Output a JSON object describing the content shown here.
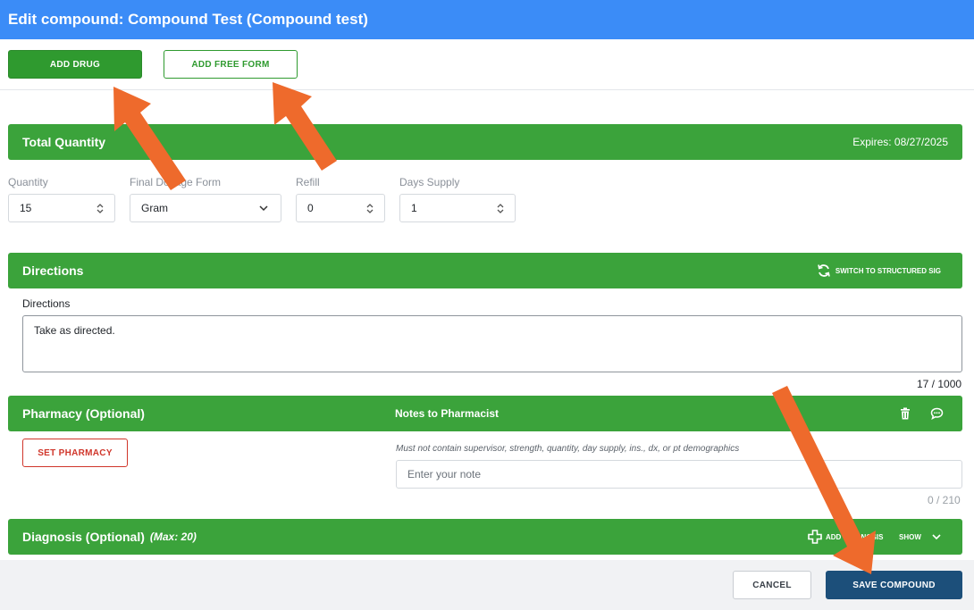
{
  "title": "Edit compound: Compound Test (Compound test)",
  "toolbar": {
    "add_drug": "ADD DRUG",
    "add_free_form": "ADD FREE FORM"
  },
  "total_quantity": {
    "heading": "Total Quantity",
    "expires": "Expires: 08/27/2025",
    "quantity_label": "Quantity",
    "quantity_value": "15",
    "form_label": "Final Dosage Form",
    "form_value": "Gram",
    "refill_label": "Refill",
    "refill_value": "0",
    "days_label": "Days Supply",
    "days_value": "1"
  },
  "directions": {
    "heading": "Directions",
    "switch_label": "SWITCH TO STRUCTURED SIG",
    "field_label": "Directions",
    "value": "Take as directed.",
    "counter": "17 / 1000"
  },
  "pharmacy": {
    "heading": "Pharmacy (Optional)",
    "notes_heading": "Notes to Pharmacist",
    "set_pharmacy": "SET PHARMACY",
    "note_hint": "Must not contain supervisor, strength, quantity, day supply, ins., dx, or pt demographics",
    "note_placeholder": "Enter your note",
    "note_counter": "0 / 210"
  },
  "diagnosis": {
    "heading": "Diagnosis (Optional)",
    "max": "(Max: 20)",
    "add_label": "ADD DIAGNOSIS",
    "show_label": "SHOW"
  },
  "footer": {
    "cancel": "CANCEL",
    "save": "SAVE COMPOUND"
  },
  "colors": {
    "title_bar": "#3b8cf7",
    "section_green": "#3ba33b",
    "save_button": "#1c4f7a",
    "danger": "#d0362b",
    "annotation_arrow": "#ee6a2c"
  }
}
